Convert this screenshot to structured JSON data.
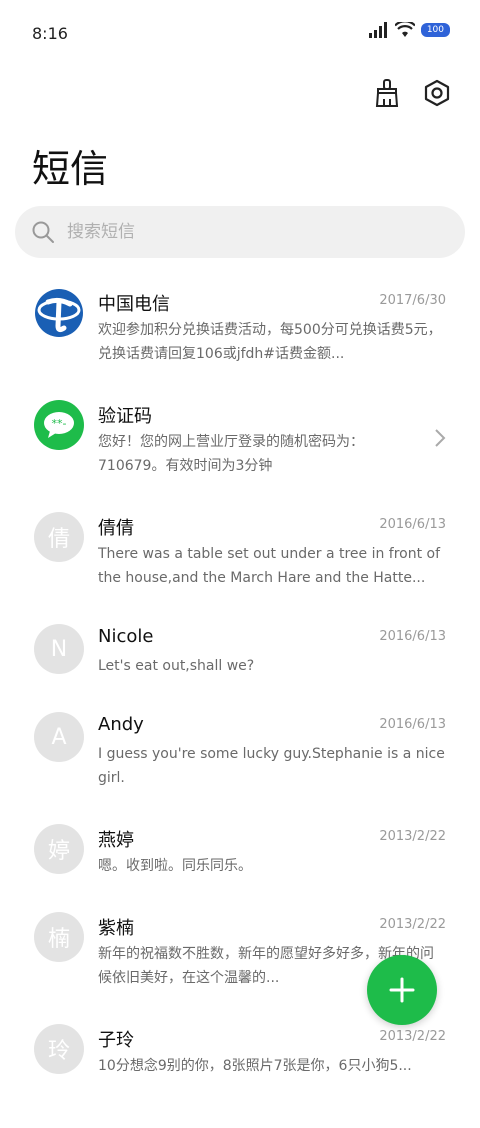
{
  "status_bar": {
    "time": "8:16",
    "battery": "100"
  },
  "page": {
    "title": "短信"
  },
  "search": {
    "placeholder": "搜索短信"
  },
  "messages": [
    {
      "name": "中国电信",
      "date": "2017/6/30",
      "preview": "欢迎参加积分兑换话费活动，每500分可兑换话费5元，兑换话费请回复106或jfdh#话费金额...",
      "avatar_type": "telecom"
    },
    {
      "name": "验证码",
      "date": "",
      "preview": "您好！您的网上营业厅登录的随机密码为：710679。有效时间为3分钟",
      "avatar_type": "chat"
    },
    {
      "name": "倩倩",
      "date": "2016/6/13",
      "preview": "There was a table set out under a tree in front of the house,and the March Hare and the Hatte...",
      "avatar_letter": "倩"
    },
    {
      "name": "Nicole",
      "date": "2016/6/13",
      "preview": "Let's eat out,shall we?",
      "avatar_letter": "N"
    },
    {
      "name": "Andy",
      "date": "2016/6/13",
      "preview": "I guess you're some lucky guy.Stephanie is a nice girl.",
      "avatar_letter": "A"
    },
    {
      "name": "燕婷",
      "date": "2013/2/22",
      "preview": "嗯。收到啦。同乐同乐。",
      "avatar_letter": "婷"
    },
    {
      "name": "紫楠",
      "date": "2013/2/22",
      "preview": "新年的祝福数不胜数，新年的愿望好多好多，新年的问候依旧美好，在这个温馨的...",
      "avatar_letter": "楠"
    },
    {
      "name": "子玲",
      "date": "2013/2/22",
      "preview": "10分想念9别的你，8张照片7张是你，6只小狗5...",
      "avatar_letter": "玲"
    }
  ],
  "colors": {
    "accent": "#1ebc4a",
    "telecom_blue": "#1a5fb4",
    "avatar_grey": "#e3e3e3"
  }
}
